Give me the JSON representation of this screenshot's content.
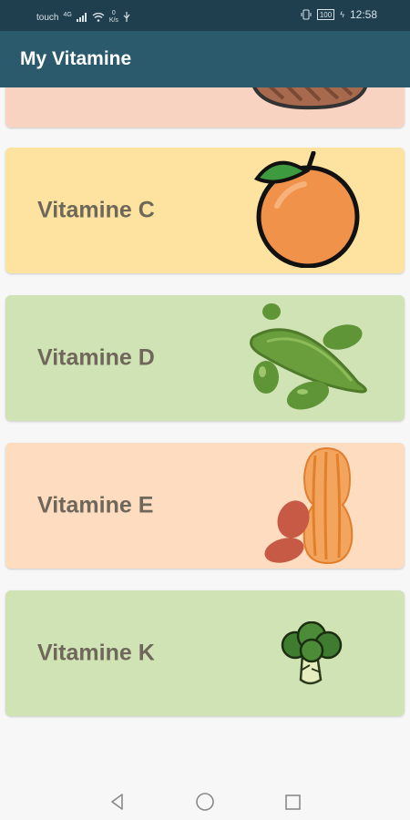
{
  "status": {
    "carrier": "touch",
    "network": "4G",
    "speed_value": "0",
    "speed_unit": "K/s",
    "battery": "100",
    "time": "12:58"
  },
  "app": {
    "title": "My Vitamine"
  },
  "cards": [
    {
      "label": "",
      "color": "#f9d3c2",
      "image": "meat-icon"
    },
    {
      "label": "Vitamine C",
      "color": "#fde39f",
      "image": "orange-icon"
    },
    {
      "label": "Vitamine D",
      "color": "#cfe3b4",
      "image": "edamame-icon"
    },
    {
      "label": "Vitamine E",
      "color": "#fddcc0",
      "image": "peanut-icon"
    },
    {
      "label": "Vitamine K",
      "color": "#cfe3b4",
      "image": "broccoli-icon"
    }
  ],
  "nav": {
    "back": "back-icon",
    "home": "home-icon",
    "recents": "recents-icon"
  }
}
